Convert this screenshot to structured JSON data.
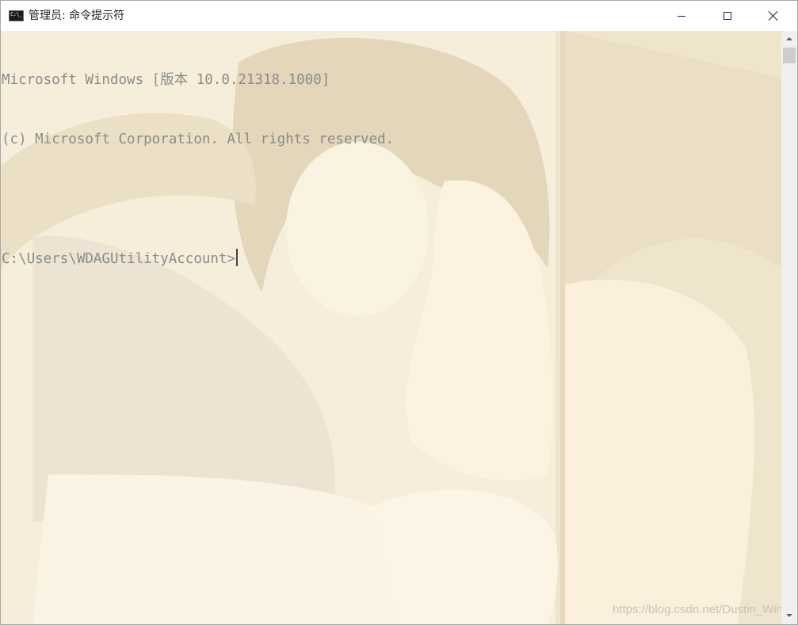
{
  "window": {
    "title": "管理员: 命令提示符",
    "icon": "cmd-icon"
  },
  "controls": {
    "minimize_icon": "minimize-icon",
    "maximize_icon": "maximize-icon",
    "close_icon": "close-icon"
  },
  "console": {
    "lines": [
      "Microsoft Windows [版本 10.0.21318.1000]",
      "(c) Microsoft Corporation. All rights reserved.",
      "",
      "C:\\Users\\WDAGUtilityAccount>"
    ],
    "text_color": "#8a8c8a",
    "background_color": "#f6eedb"
  },
  "watermark": "https://blog.csdn.net/Dustin_Win",
  "scrollbar": {
    "up_icon": "scroll-up-arrow-icon",
    "down_icon": "scroll-down-arrow-icon"
  }
}
